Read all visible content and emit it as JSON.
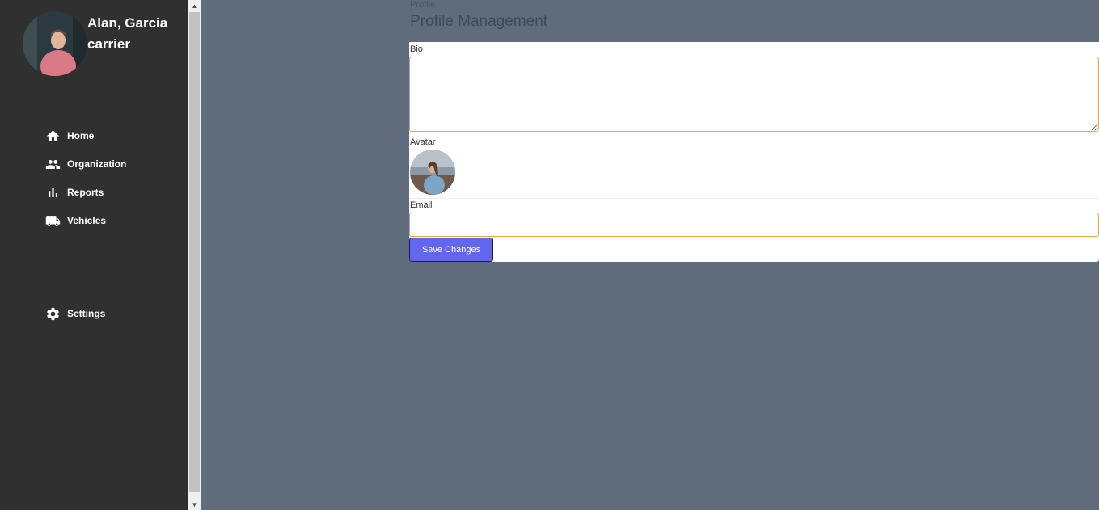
{
  "user": {
    "name_line1": "Alan, Garcia",
    "name_line2": "carrier"
  },
  "nav": {
    "items": [
      {
        "label": "Home",
        "icon": "home-icon"
      },
      {
        "label": "Organization",
        "icon": "people-icon"
      },
      {
        "label": "Reports",
        "icon": "bar-chart-icon"
      },
      {
        "label": "Vehicles",
        "icon": "truck-icon"
      }
    ],
    "settings": {
      "label": "Settings",
      "icon": "gear-icon"
    }
  },
  "breadcrumb": "Profile",
  "page_title": "Profile Management",
  "form": {
    "bio_label": "Bio",
    "bio_value": "",
    "avatar_label": "Avatar",
    "email_label": "Email",
    "email_value": "",
    "save_label": "Save Changes"
  },
  "colors": {
    "sidebar": "#303030",
    "background": "#5f6c7b",
    "accent": "#6366f1",
    "focus_border": "#f0a53a"
  }
}
